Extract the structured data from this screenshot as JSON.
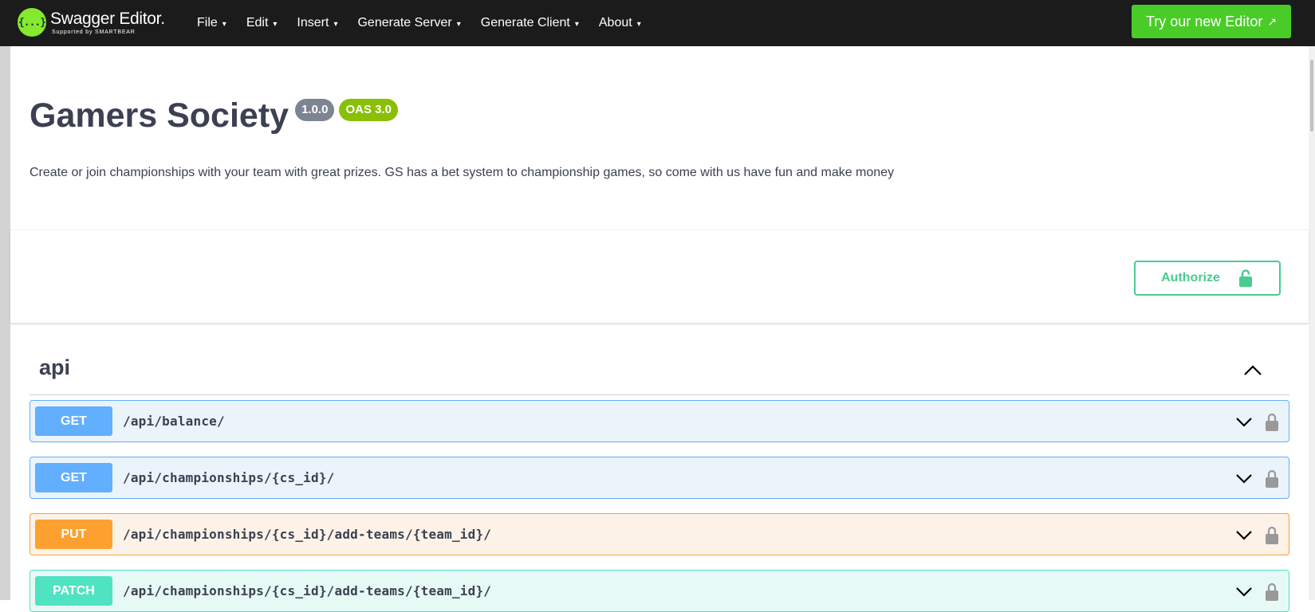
{
  "header": {
    "logo_symbol": "{...}",
    "logo_title": "Swagger Editor.",
    "logo_subtitle": "Supported by SMARTBEAR",
    "menu": [
      {
        "label": "File"
      },
      {
        "label": "Edit"
      },
      {
        "label": "Insert"
      },
      {
        "label": "Generate Server"
      },
      {
        "label": "Generate Client"
      },
      {
        "label": "About"
      }
    ],
    "caret": "▾",
    "try_button": "Try our new Editor",
    "try_button_arrow": "↗"
  },
  "info": {
    "title": "Gamers Society",
    "version_badge": "1.0.0",
    "oas_badge": "OAS 3.0",
    "description": "Create or join championships with your team with great prizes. GS has a bet system to championship games, so come with us have fun and make money"
  },
  "scheme": {
    "authorize_label": "Authorize"
  },
  "tag": {
    "name": "api",
    "operations": [
      {
        "method": "GET",
        "path": "/api/balance/"
      },
      {
        "method": "GET",
        "path": "/api/championships/{cs_id}/"
      },
      {
        "method": "PUT",
        "path": "/api/championships/{cs_id}/add-teams/{team_id}/"
      },
      {
        "method": "PATCH",
        "path": "/api/championships/{cs_id}/add-teams/{team_id}/"
      }
    ]
  },
  "colors": {
    "accent_green": "#49cc27",
    "authorize_green": "#49cc90",
    "get": "#61affe",
    "put": "#fca130",
    "patch": "#50e3c2",
    "version_badge": "#7d8492",
    "oas_badge": "#89bf04"
  },
  "icons": {
    "logo": "swagger-logo-icon",
    "authorize": "lock-open-icon",
    "tag_toggle": "chevron-up-icon",
    "op_expand": "chevron-down-icon",
    "op_lock": "lock-icon"
  }
}
